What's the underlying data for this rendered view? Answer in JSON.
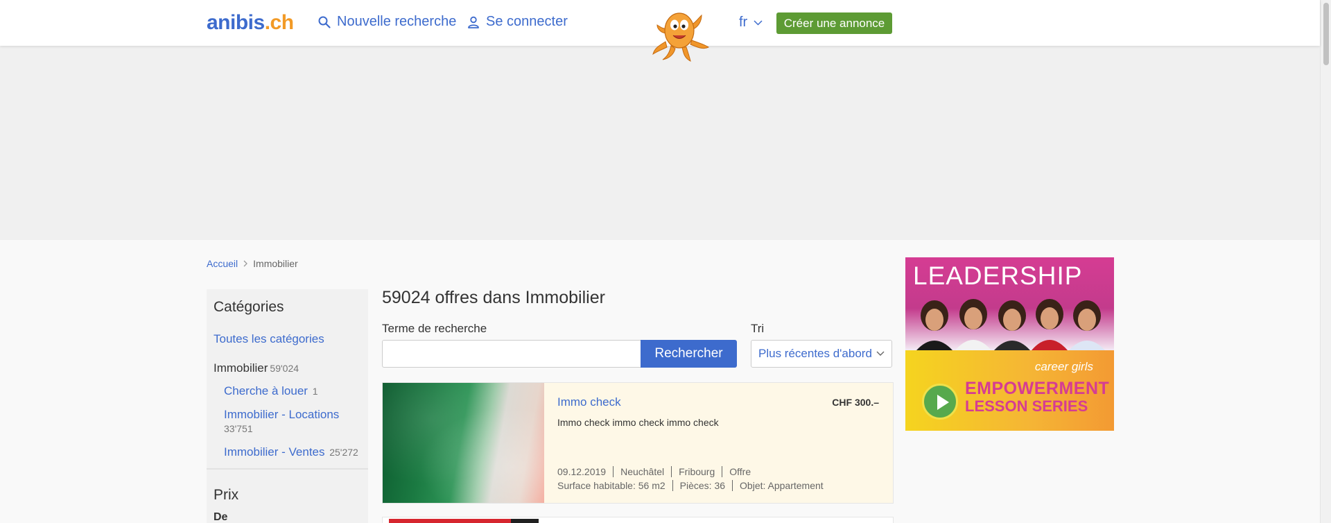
{
  "header": {
    "logo_part1": "anibis",
    "logo_part2": ".ch",
    "new_search": "Nouvelle recherche",
    "login": "Se connecter",
    "lang": "fr",
    "create_ad": "Créer une annonce"
  },
  "breadcrumb": {
    "home": "Accueil",
    "current": "Immobilier"
  },
  "sidebar": {
    "title": "Catégories",
    "all": "Toutes les catégories",
    "current_label": "Immobilier",
    "current_count": "59'024",
    "subcategories": [
      {
        "label": "Cherche à louer",
        "count": "1"
      },
      {
        "label": "Immobilier - Locations",
        "count": "33'751"
      },
      {
        "label": "Immobilier - Ventes",
        "count": "25'272"
      }
    ],
    "price_title": "Prix",
    "price_from": "De"
  },
  "main": {
    "results_title": "59024 offres dans Immobilier",
    "search_label": "Terme de recherche",
    "search_value": "",
    "search_button": "Rechercher",
    "sort_label": "Tri",
    "sort_value": "Plus récentes d'abord"
  },
  "listings": [
    {
      "title": "Immo check",
      "price": "CHF 300.–",
      "description": "Immo check immo check immo check",
      "meta1": [
        "09.12.2019",
        "Neuchâtel",
        "Fribourg",
        "Offre"
      ],
      "meta2": [
        "Surface habitable: 56 m2",
        "Pièces: 36",
        "Objet: Appartement"
      ]
    }
  ],
  "side_ad": {
    "headline": "LEADERSHIP",
    "brand": "career girls",
    "line1": "EMPOWERMENT",
    "line2": "LESSON SERIES"
  },
  "colors": {
    "link": "#3d6bcd",
    "logo_accent": "#f29a26",
    "create_button": "#5d9b34",
    "listing_bg": "#fef8e7"
  }
}
